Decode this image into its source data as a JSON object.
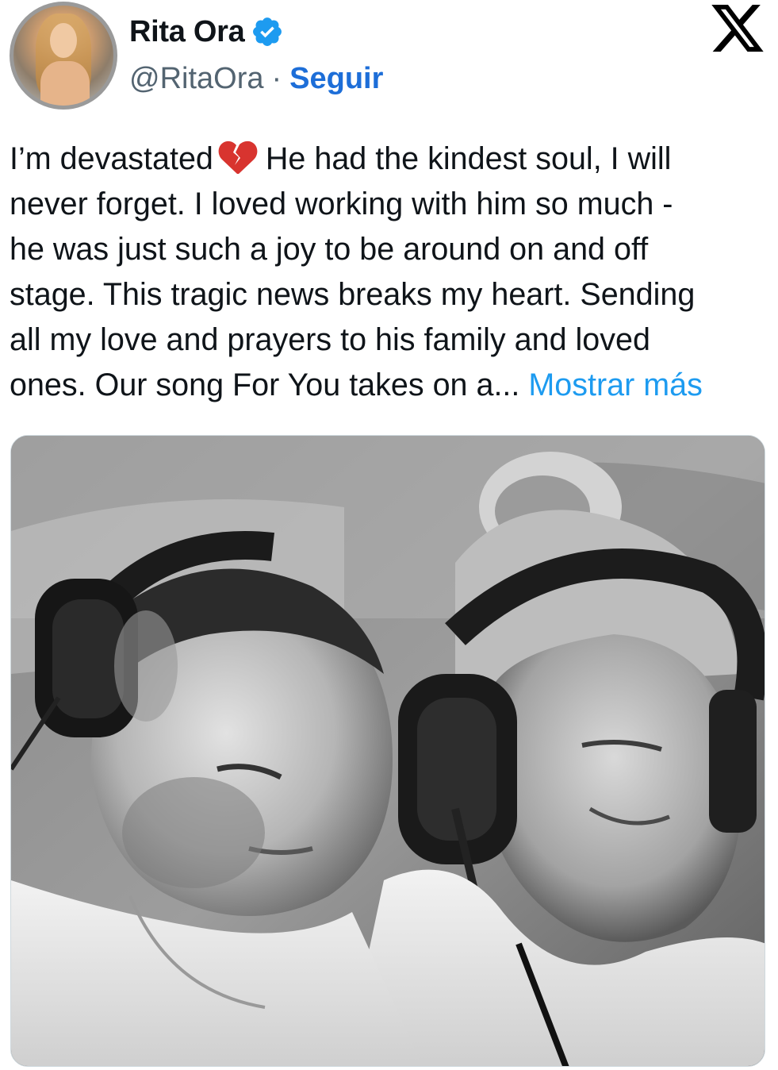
{
  "tweet": {
    "author": {
      "display_name": "Rita Ora",
      "handle": "@RitaOra",
      "separator": "·",
      "follow_label": "Seguir",
      "verified": true,
      "avatar_icon": "avatar"
    },
    "platform_logo": "x-logo-icon",
    "text_part1": "I’m devastated",
    "emoji": "broken-heart-icon",
    "text_part2": "He had the kindest soul, I will\nnever forget. I loved working with him so much -\nhe was just such a joy to be around on and off\nstage. This tragic news breaks my heart. Sending\nall my love and prayers to his family and loved\nones. Our song For You takes on a...",
    "show_more_label": "Mostrar más",
    "colors": {
      "link": "#1d9bf0",
      "follow": "#1d6ed8",
      "verified_badge": "#1d9bf0",
      "secondary_text": "#536471"
    },
    "media": {
      "type": "black-and-white-photo"
    }
  }
}
